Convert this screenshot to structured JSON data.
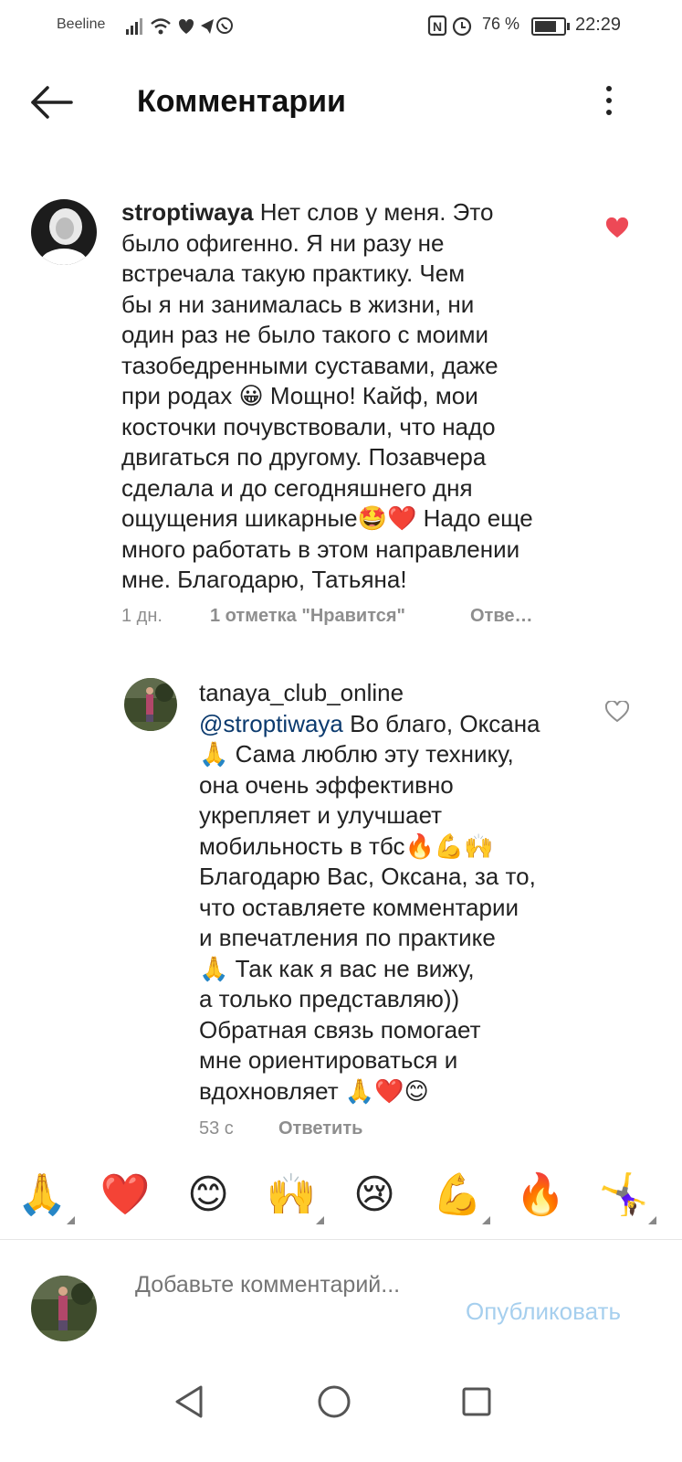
{
  "status_bar": {
    "carrier": "Beeline",
    "battery_percent": "76 %",
    "battery_level": 0.76,
    "time": "22:29"
  },
  "header": {
    "title": "Комментарии",
    "back_icon": "arrow-left-icon",
    "more_icon": "more-vertical-icon"
  },
  "comments": [
    {
      "username": "stroptiwaya",
      "lines": [
        "Нет слов у меня. Это",
        "было офигенно. Я ни разу не",
        "встречала такую практику. Чем",
        "бы я ни занималась в жизни, ни",
        "один раз не было такого с моими",
        "тазобедренными суставами, даже",
        "при родах 😀 Мощно! Кайф, мои",
        "косточки почувствовали, что надо",
        "двигаться по другому. Позавчера",
        "сделала и до сегодняшнего дня",
        "ощущения шикарные🤩❤️ Надо еще",
        "много работать в этом направлении",
        "мне. Благодарю, Татьяна!"
      ],
      "time": "1 дн.",
      "likes": "1 отметка \"Нравится\"",
      "reply": "Отве…",
      "liked": true,
      "like_color": "#ed4956"
    },
    {
      "username": "tanaya_club_online",
      "mention": "@stroptiwaya",
      "lines": [
        "Во благо, Оксана",
        "🙏 Сама люблю эту технику,",
        "она очень эффективно",
        "укрепляет и улучшает",
        "мобильность в тбс🔥💪🙌",
        "Благодарю Вас, Оксана, за то,",
        "что оставляете комментарии",
        "и впечатления по практике",
        "🙏 Так как я вас не вижу,",
        "а только представляю))",
        "Обратная связь помогает",
        "мне ориентироваться и",
        "вдохновляет 🙏❤️😊"
      ],
      "time": "53 с",
      "reply": "Ответить",
      "liked": false
    }
  ],
  "emoji_bar": [
    "🙏",
    "❤️",
    "😊",
    "🙌",
    "😢",
    "💪",
    "🔥",
    "🤸‍♀️"
  ],
  "composer": {
    "placeholder": "Добавьте комментарий...",
    "publish": "Опубликовать",
    "publish_color": "#a6cfee"
  },
  "nav_bar": {
    "icons": [
      "back-triangle-icon",
      "home-circle-icon",
      "recents-square-icon"
    ]
  }
}
